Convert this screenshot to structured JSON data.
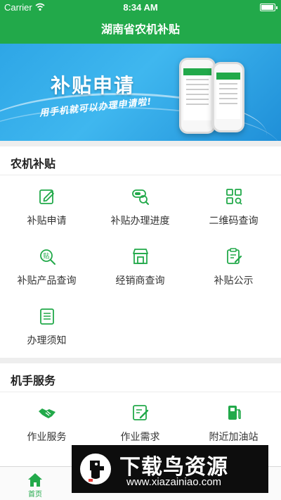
{
  "status_bar": {
    "carrier": "Carrier",
    "time": "8:34 AM"
  },
  "nav": {
    "title": "湖南省农机补贴"
  },
  "banner": {
    "title": "补贴申请",
    "subtitle": "用手机就可以办理申请啦!"
  },
  "sections": [
    {
      "title": "农机补贴",
      "items": [
        {
          "label": "补贴申请",
          "icon": "edit-icon"
        },
        {
          "label": "补贴办理进度",
          "icon": "progress-search-icon"
        },
        {
          "label": "二维码查询",
          "icon": "qrcode-icon"
        },
        {
          "label": "补贴产品查询",
          "icon": "product-search-icon"
        },
        {
          "label": "经销商查询",
          "icon": "store-icon"
        },
        {
          "label": "补贴公示",
          "icon": "notice-icon"
        },
        {
          "label": "办理须知",
          "icon": "document-icon"
        }
      ]
    },
    {
      "title": "机手服务",
      "items": [
        {
          "label": "作业服务",
          "icon": "handshake-icon"
        },
        {
          "label": "作业需求",
          "icon": "demand-icon"
        },
        {
          "label": "附近加油站",
          "icon": "gas-station-icon"
        }
      ]
    }
  ],
  "tab_bar": {
    "items": [
      {
        "label": "首页",
        "icon": "home-icon",
        "active": true
      }
    ]
  },
  "watermark": {
    "name": "下载鸟资源",
    "url": "www.xiazainiao.com"
  },
  "colors": {
    "primary": "#22a94a",
    "banner": "#2ea6e6",
    "background": "#eeeeee",
    "text": "#333333"
  }
}
